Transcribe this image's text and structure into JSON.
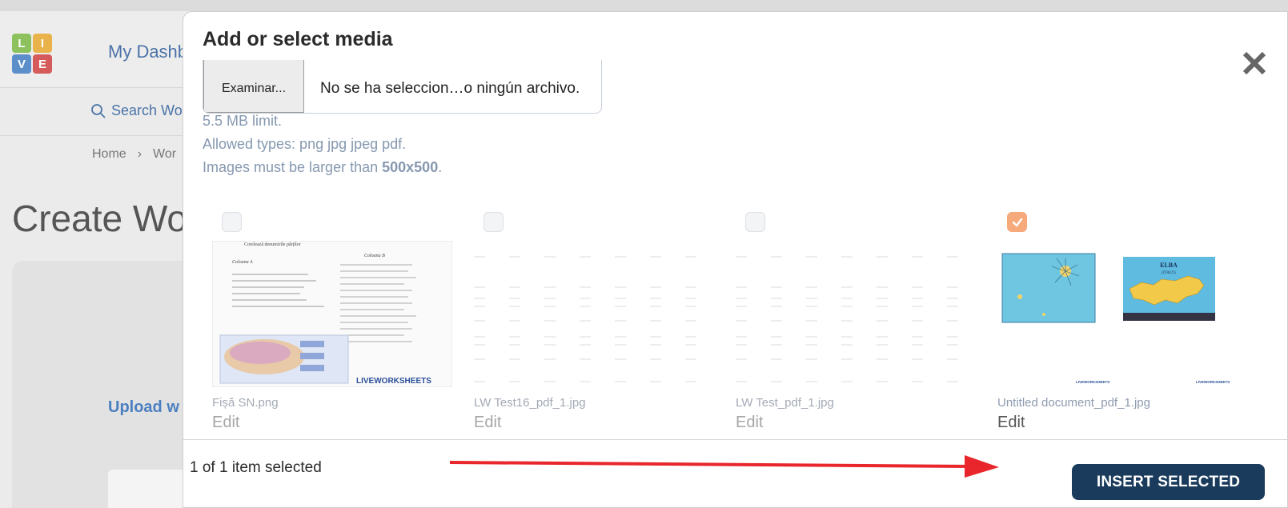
{
  "background": {
    "logo_letters": [
      "L",
      "I",
      "V",
      "E"
    ],
    "dashboard_label": "My Dashb",
    "search_label": "Search Wo",
    "breadcrumb": [
      "Home",
      "Wor"
    ],
    "page_title": "Create Wo",
    "upload_label": "Upload w"
  },
  "modal": {
    "title": "Add or select media",
    "browse_button": "Examinar...",
    "file_status": "No se ha seleccion…o ningún archivo.",
    "limit_text": "5.5 MB limit.",
    "types_text": "Allowed types: png jpg jpeg pdf.",
    "size_prefix": "Images must be larger than ",
    "size_value": "500x500",
    "size_suffix": ".",
    "media": [
      {
        "name": "Fișă SN.png",
        "edit": "Edit",
        "size": "4 ",
        "selected": false
      },
      {
        "name": "LW Test16_pdf_1.jpg",
        "edit": "Edit",
        "size": "15 ",
        "selected": false
      },
      {
        "name": "LW Test_pdf_1.jpg",
        "edit": "Edit",
        "size": "15 ",
        "selected": false
      },
      {
        "name": "Untitled document_pdf_1.jpg",
        "edit": "Edit",
        "size": "24 ",
        "selected": true
      }
    ],
    "thumb_text": {
      "worksheet_header": "Corelează denumirile părților",
      "coloana_a": "Coloana A",
      "coloana_b": "Coloana B",
      "watermark": "LIVEWORKSHEETS",
      "map_title": "ELBA",
      "map_subtitle": "(ITALY)"
    },
    "footer": {
      "selection_count": "1 of 1 item selected",
      "insert_button": "INSERT SELECTED"
    }
  },
  "colors": {
    "primary_button": "#1a3b5c",
    "checkbox_checked": "#f6a97b",
    "annotation_arrow": "#e8262b",
    "hint_text": "#8698b0"
  }
}
